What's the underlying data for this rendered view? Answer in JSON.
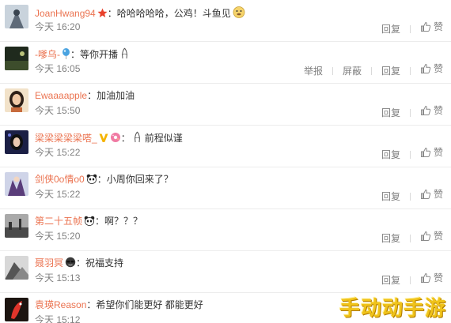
{
  "comments": [
    {
      "user": "JoanHwang94",
      "text": "哈哈哈哈哈，公鸡！斗鱼见",
      "time": "今天 16:20",
      "actions": [
        "回复"
      ],
      "like": "赞",
      "avatar_color": "#9aa7b5"
    },
    {
      "user": "-嗲乌-",
      "text": "等你开播",
      "time": "今天 16:05",
      "actions": [
        "举报",
        "屏蔽",
        "回复"
      ],
      "like": "赞",
      "avatar_color": "#2e3a2c"
    },
    {
      "user": "Ewaaaapple",
      "text": "加油加油",
      "time": "今天 15:50",
      "actions": [
        "回复"
      ],
      "like": "赞",
      "avatar_color": "#d2a26c"
    },
    {
      "user": "梁梁梁梁梁嗒_",
      "text": "前程似谨",
      "time": "今天 15:22",
      "actions": [
        "回复"
      ],
      "like": "赞",
      "avatar_color": "#262a55"
    },
    {
      "user": "剑侠0o情o0",
      "text": "小周你回来了？",
      "time": "今天 15:22",
      "actions": [
        "回复"
      ],
      "like": "赞",
      "avatar_color": "#7d6a8e"
    },
    {
      "user": "第二十五帧",
      "text": "啊？？？",
      "time": "今天 15:20",
      "actions": [
        "回复"
      ],
      "like": "赞",
      "avatar_color": "#8c8c8c"
    },
    {
      "user": "聂羽冥",
      "text": "祝福支持",
      "time": "今天 15:13",
      "actions": [
        "回复"
      ],
      "like": "赞",
      "avatar_color": "#6b6b6b"
    },
    {
      "user": "袁瑛Reason",
      "text": "希望你们能更好 都能更好",
      "time": "今天 15:12",
      "actions": [
        "回复"
      ],
      "like": "赞",
      "avatar_color": "#3a2a22"
    }
  ],
  "watermark": "手动动手游"
}
